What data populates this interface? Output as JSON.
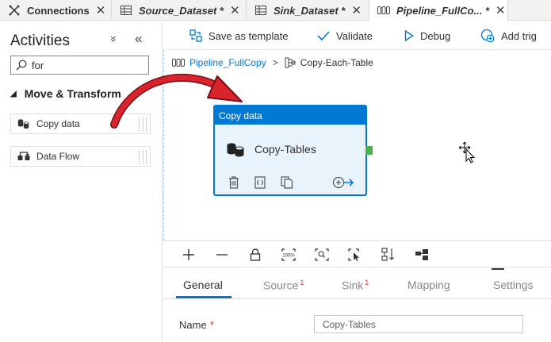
{
  "tabs": [
    {
      "label": "Connections",
      "icon": "connections-icon"
    },
    {
      "label": "Source_Dataset *",
      "icon": "table-icon"
    },
    {
      "label": "Sink_Dataset *",
      "icon": "table-icon"
    },
    {
      "label": "Pipeline_FullCo... *",
      "icon": "pipeline-icon"
    }
  ],
  "activities": {
    "title": "Activities",
    "collapse_all": "»",
    "hide": "«",
    "search": {
      "value": "for"
    },
    "category": "Move & Transform",
    "items": [
      {
        "label": "Copy data",
        "icon": "copy-data-icon"
      },
      {
        "label": "Data Flow",
        "icon": "data-flow-icon"
      }
    ]
  },
  "toolbar": {
    "save_template": "Save as template",
    "validate": "Validate",
    "debug": "Debug",
    "add_trigger": "Add trig"
  },
  "breadcrumb": {
    "pipeline": "Pipeline_FullCopy",
    "separator": ">",
    "activity": "Copy-Each-Table"
  },
  "node": {
    "header": "Copy data",
    "name": "Copy-Tables"
  },
  "properties": {
    "tabs": [
      {
        "label": "General",
        "badge": ""
      },
      {
        "label": "Source",
        "badge": "1"
      },
      {
        "label": "Sink",
        "badge": "1"
      },
      {
        "label": "Mapping",
        "badge": ""
      },
      {
        "label": "Settings",
        "badge": ""
      }
    ],
    "name_label": "Name",
    "required_mark": "*",
    "name_value": "Copy-Tables"
  },
  "colors": {
    "accent": "#0078d4",
    "node_fill": "#e8f3fc",
    "drag_arrow": "#d9232d",
    "port": "#4caf50"
  }
}
